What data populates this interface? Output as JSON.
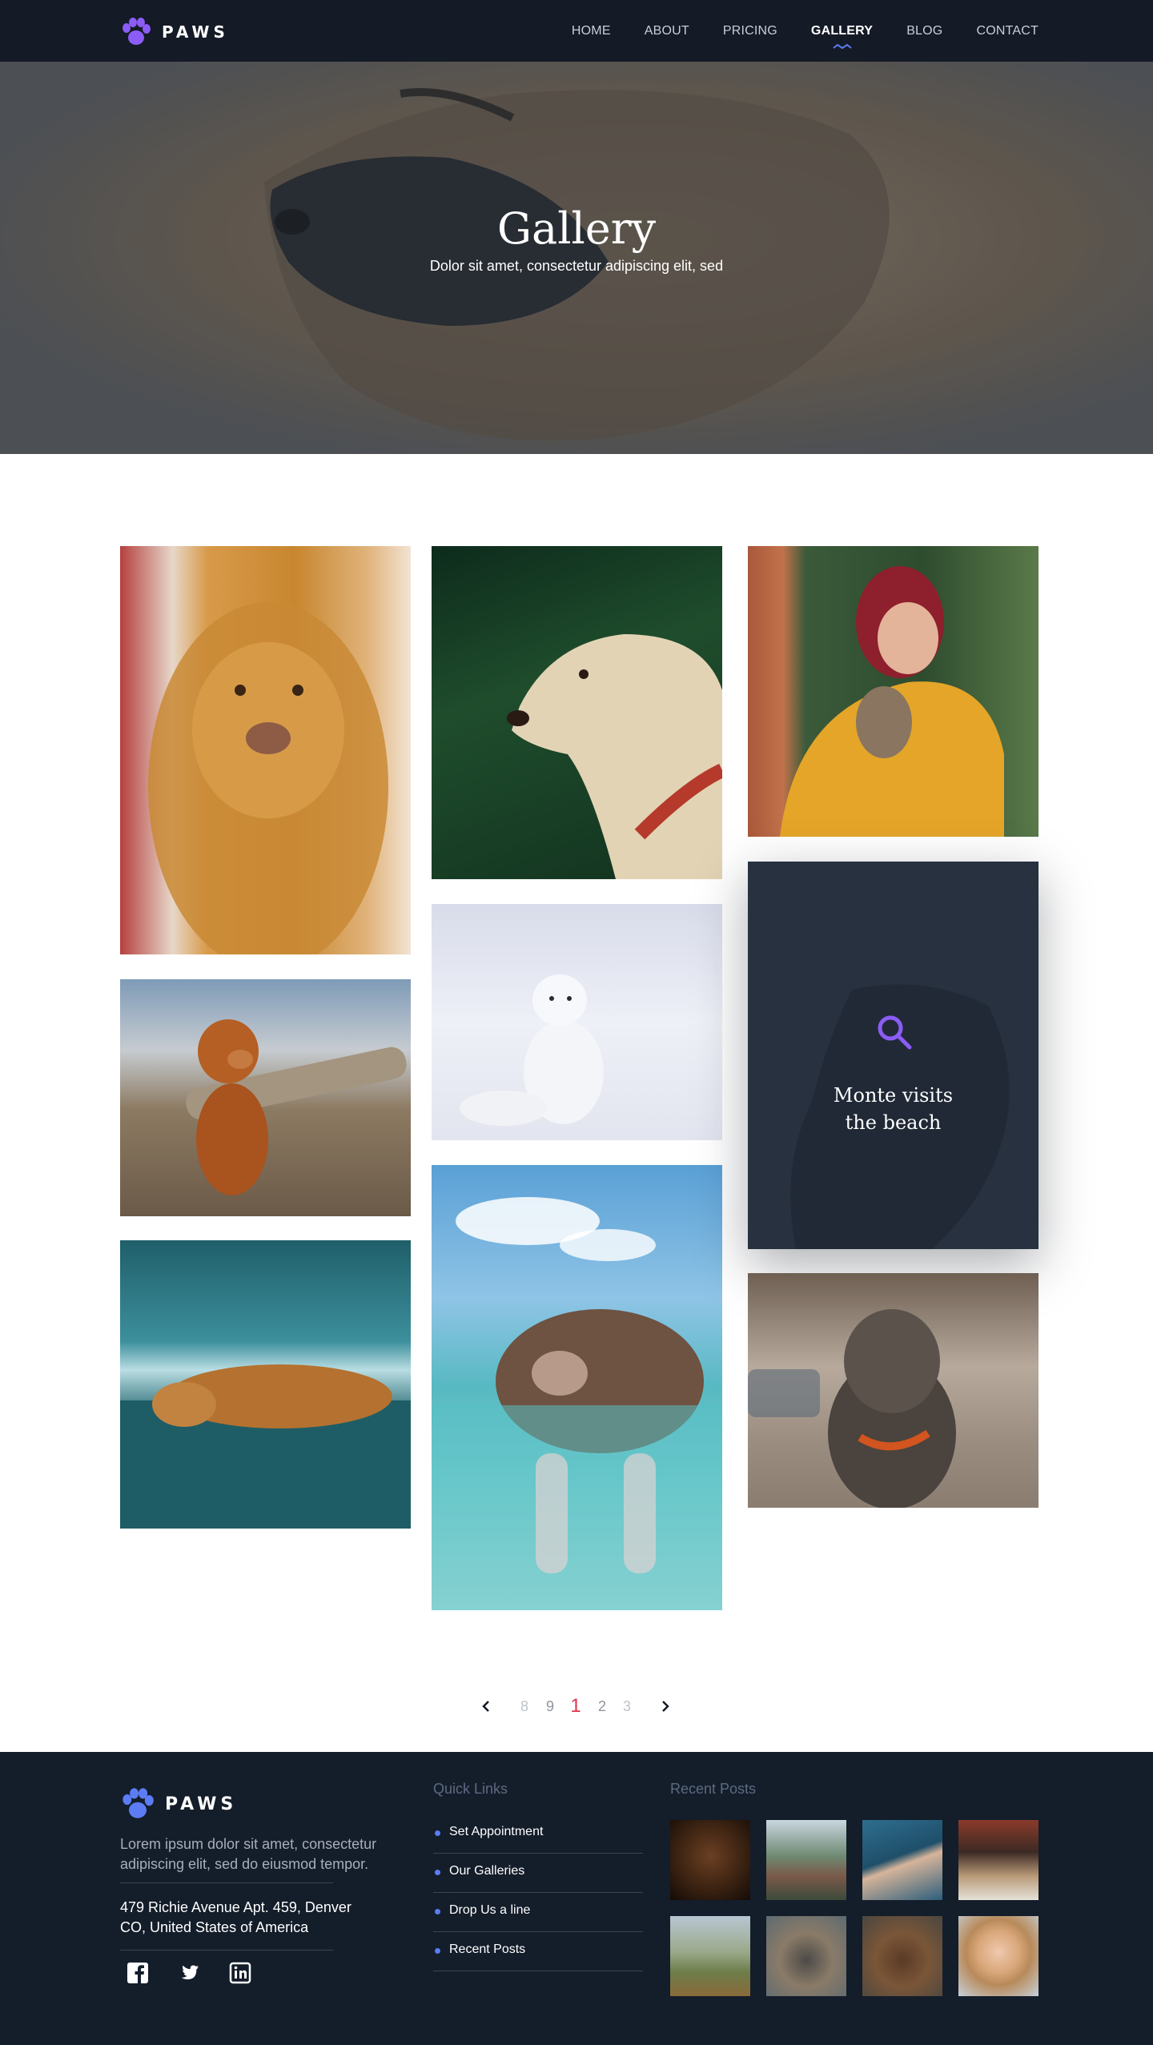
{
  "nav": {
    "logo_text": "PAWS",
    "items": [
      {
        "label": "HOME"
      },
      {
        "label": "ABOUT"
      },
      {
        "label": "PRICING"
      },
      {
        "label": "GALLERY",
        "active": true
      },
      {
        "label": "BLOG"
      },
      {
        "label": "CONTACT"
      }
    ]
  },
  "hero": {
    "title": "Gallery",
    "subtitle": "Dolor sit amet, consectetur adipiscing elit, sed"
  },
  "gallery": {
    "featured_title_line1": "Monte visits",
    "featured_title_line2": "the beach",
    "featured_icon": "search-icon"
  },
  "pagination": {
    "prev_icon": "chevron-left-icon",
    "next_icon": "chevron-right-icon",
    "pages": [
      "8",
      "9",
      "1",
      "2",
      "3"
    ],
    "current": "1"
  },
  "footer": {
    "logo_text": "PAWS",
    "description": "Lorem ipsum dolor sit amet, consectetur adipiscing elit, sed do eiusmod tempor.",
    "address_line1": "479 Richie Avenue Apt. 459, Denver",
    "address_line2": "CO, United States of America",
    "socials": [
      "facebook-icon",
      "twitter-icon",
      "linkedin-icon"
    ],
    "quick_links_heading": "Quick Links",
    "quick_links": [
      "Set Appointment",
      "Our Galleries",
      "Drop Us a line",
      "Recent Posts"
    ],
    "recent_posts_heading": "Recent Posts"
  },
  "colors": {
    "nav_bg": "#141a26",
    "footer_bg": "#141d2a",
    "accent_purple": "#8b5cf6",
    "accent_blue": "#5b7cf2",
    "current_page": "#e0334d"
  }
}
